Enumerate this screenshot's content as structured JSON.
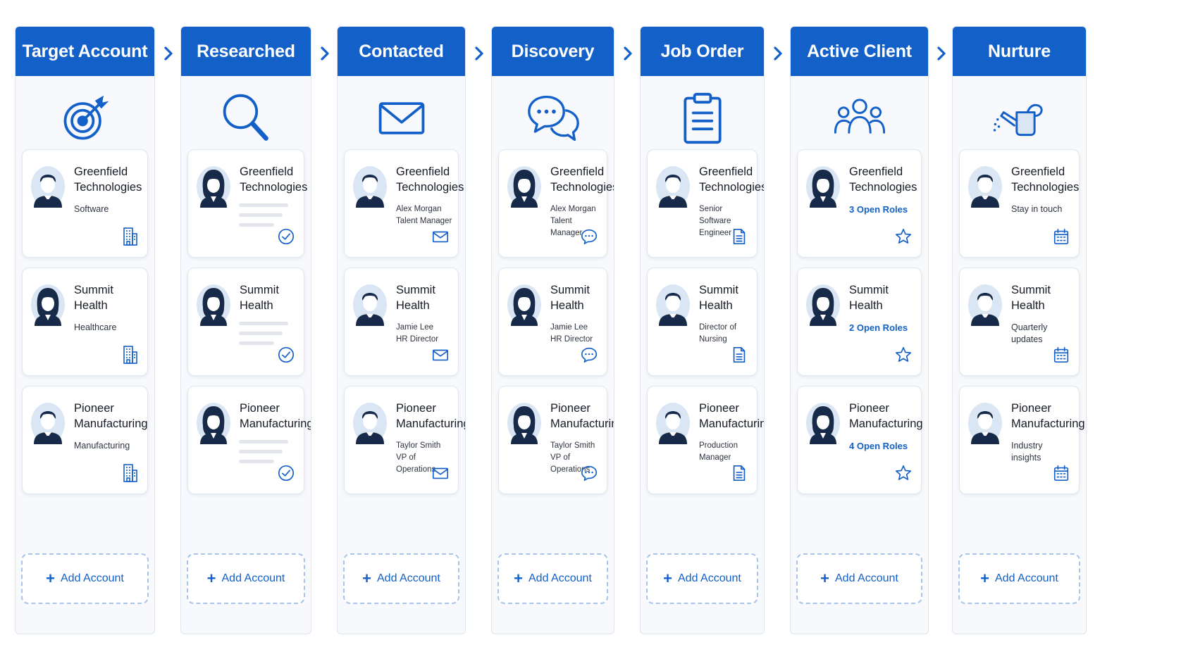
{
  "columns": [
    {
      "title": "Target Account",
      "icon": "target-icon",
      "add_label": "Add Account",
      "cards": [
        {
          "name": "Greenfield\nTechnologies",
          "sub": "Software",
          "avatar": "male",
          "action_icon": "building-icon"
        },
        {
          "name": "Summit\nHealth",
          "sub": "Healthcare",
          "avatar": "female",
          "action_icon": "building-icon"
        },
        {
          "name": "Pioneer\nManufacturing",
          "sub": "Manufacturing",
          "avatar": "male",
          "action_icon": "building-icon"
        }
      ]
    },
    {
      "title": "Researched",
      "icon": "magnifier-icon",
      "add_label": "Add Account",
      "cards": [
        {
          "name": "Greenfield\nTechnologies",
          "sub": "",
          "avatar": "female",
          "action_icon": "check-circle-icon"
        },
        {
          "name": "Summit\nHealth",
          "sub": "",
          "avatar": "female",
          "action_icon": "check-circle-icon"
        },
        {
          "name": "Pioneer\nManufacturing",
          "sub": "",
          "avatar": "female",
          "action_icon": "check-circle-icon"
        }
      ]
    },
    {
      "title": "Contacted",
      "icon": "envelope-icon",
      "add_label": "Add Account",
      "cards": [
        {
          "name": "Greenfield\nTechnologies",
          "sub": "Alex Morgan\nTalent Manager",
          "avatar": "male",
          "action_icon": "mail-icon"
        },
        {
          "name": "Summit\nHealth",
          "sub": "Jamie Lee\nHR Director",
          "avatar": "male",
          "action_icon": "mail-icon"
        },
        {
          "name": "Pioneer\nManufacturing",
          "sub": "Taylor Smith\nVP of Operations",
          "avatar": "male",
          "action_icon": "mail-icon"
        }
      ]
    },
    {
      "title": "Discovery",
      "icon": "chat-bubbles-icon",
      "add_label": "Add Account",
      "cards": [
        {
          "name": "Greenfield\nTechnologies",
          "sub": "Alex Morgan\nTalent Manager",
          "avatar": "female",
          "action_icon": "chat-icon"
        },
        {
          "name": "Summit\nHealth",
          "sub": "Jamie Lee\nHR Director",
          "avatar": "female",
          "action_icon": "chat-icon"
        },
        {
          "name": "Pioneer\nManufacturing",
          "sub": "Taylor Smith\nVP of Operations",
          "avatar": "female",
          "action_icon": "chat-icon"
        }
      ]
    },
    {
      "title": "Job Order",
      "icon": "clipboard-icon",
      "add_label": "Add Account",
      "cards": [
        {
          "name": "Greenfield\nTechnologies",
          "sub": "Senior Software\nEngineer",
          "avatar": "male",
          "action_icon": "document-icon"
        },
        {
          "name": "Summit\nHealth",
          "sub": "Director of\nNursing",
          "avatar": "male",
          "action_icon": "document-icon"
        },
        {
          "name": "Pioneer\nManufacturing",
          "sub": "Production\nManager",
          "avatar": "male",
          "action_icon": "document-icon"
        }
      ]
    },
    {
      "title": "Active Client",
      "icon": "group-icon",
      "add_label": "Add Account",
      "cards": [
        {
          "name": "Greenfield\nTechnologies",
          "sub": "3 Open Roles",
          "avatar": "female",
          "action_icon": "star-icon",
          "accent": true
        },
        {
          "name": "Summit\nHealth",
          "sub": "2 Open Roles",
          "avatar": "female",
          "action_icon": "star-icon",
          "accent": true
        },
        {
          "name": "Pioneer\nManufacturing",
          "sub": "4 Open Roles",
          "avatar": "female",
          "action_icon": "star-icon",
          "accent": true
        }
      ]
    },
    {
      "title": "Nurture",
      "icon": "watering-can-icon",
      "add_label": "Add Account",
      "cards": [
        {
          "name": "Greenfield\nTechnologies",
          "sub": "Stay in touch",
          "avatar": "male",
          "action_icon": "calendar-icon"
        },
        {
          "name": "Summit\nHealth",
          "sub": "Quarterly updates",
          "avatar": "male",
          "action_icon": "calendar-icon"
        },
        {
          "name": "Pioneer\nManufacturing",
          "sub": "Industry insights",
          "avatar": "male",
          "action_icon": "calendar-icon"
        }
      ]
    }
  ],
  "colors": {
    "header": "#1360c9",
    "accent": "#1360c9",
    "avatar_dark": "#172a4a",
    "avatar_bg": "#dbe6f5"
  }
}
